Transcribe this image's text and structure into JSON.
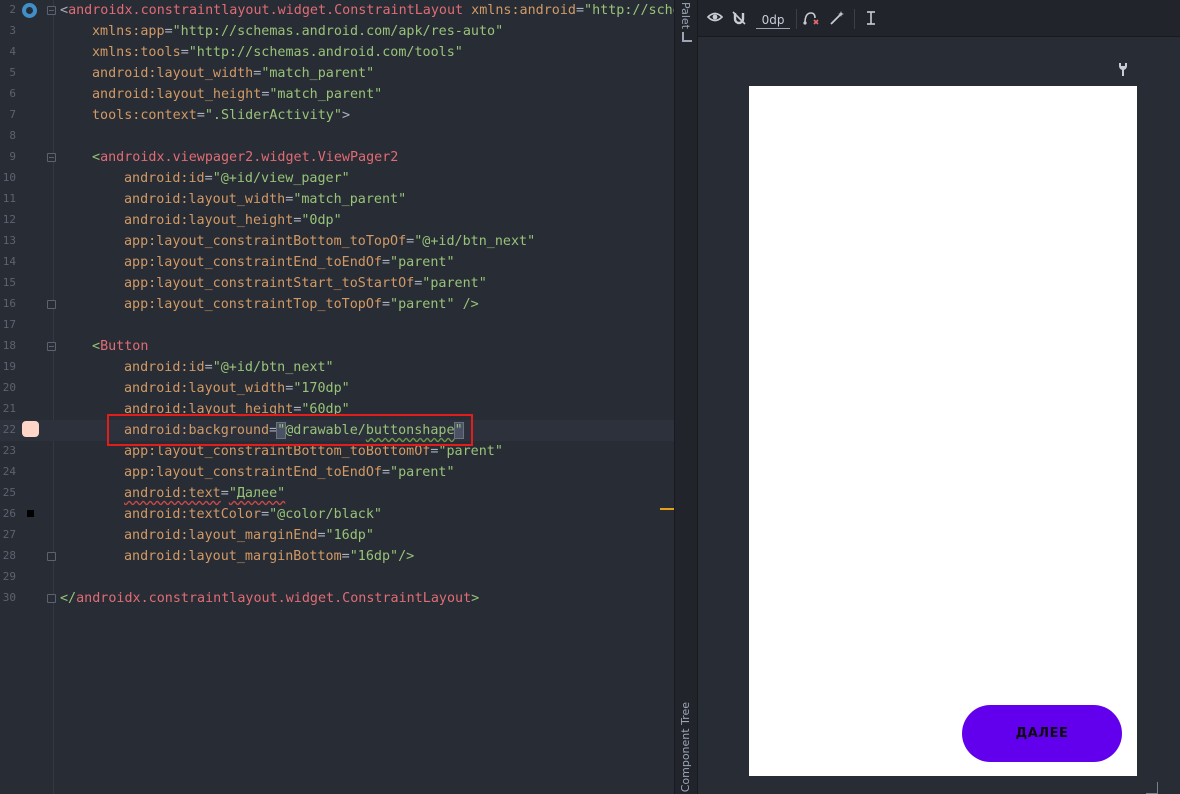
{
  "editor": {
    "lines": [
      {
        "n": "2",
        "indent": 0,
        "tokens": [
          [
            "br",
            "<"
          ],
          [
            "tag",
            "androidx.constraintlayout.widget.ConstraintLayout"
          ],
          [
            "plain",
            " "
          ],
          [
            "ns",
            "xmlns:android"
          ],
          [
            "eq",
            "="
          ],
          [
            "str",
            "\"http://sche"
          ]
        ]
      },
      {
        "n": "3",
        "indent": 1,
        "tokens": [
          [
            "ns",
            "xmlns:app"
          ],
          [
            "eq",
            "="
          ],
          [
            "str",
            "\"http://schemas.android.com/apk/res-auto\""
          ]
        ]
      },
      {
        "n": "4",
        "indent": 1,
        "tokens": [
          [
            "ns",
            "xmlns:tools"
          ],
          [
            "eq",
            "="
          ],
          [
            "str",
            "\"http://schemas.android.com/tools\""
          ]
        ]
      },
      {
        "n": "5",
        "indent": 1,
        "tokens": [
          [
            "attr",
            "android:layout_width"
          ],
          [
            "eq",
            "="
          ],
          [
            "str",
            "\"match_parent\""
          ]
        ]
      },
      {
        "n": "6",
        "indent": 1,
        "tokens": [
          [
            "attr",
            "android:layout_height"
          ],
          [
            "eq",
            "="
          ],
          [
            "str",
            "\"match_parent\""
          ]
        ]
      },
      {
        "n": "7",
        "indent": 1,
        "tokens": [
          [
            "attr",
            "tools:context"
          ],
          [
            "eq",
            "="
          ],
          [
            "str",
            "\".SliderActivity\""
          ],
          [
            "br",
            ">"
          ]
        ]
      },
      {
        "n": "8",
        "indent": 0,
        "tokens": []
      },
      {
        "n": "9",
        "indent": 1,
        "tokens": [
          [
            "br2",
            "<"
          ],
          [
            "tag",
            "androidx.viewpager2.widget.ViewPager2"
          ]
        ]
      },
      {
        "n": "10",
        "indent": 2,
        "tokens": [
          [
            "attr",
            "android:id"
          ],
          [
            "eq",
            "="
          ],
          [
            "str",
            "\"@+id/view_pager\""
          ]
        ]
      },
      {
        "n": "11",
        "indent": 2,
        "tokens": [
          [
            "attr",
            "android:layout_width"
          ],
          [
            "eq",
            "="
          ],
          [
            "str",
            "\"match_parent\""
          ]
        ]
      },
      {
        "n": "12",
        "indent": 2,
        "tokens": [
          [
            "attr",
            "android:layout_height"
          ],
          [
            "eq",
            "="
          ],
          [
            "str",
            "\"0dp\""
          ]
        ]
      },
      {
        "n": "13",
        "indent": 2,
        "tokens": [
          [
            "attr",
            "app:layout_constraintBottom_toTopOf"
          ],
          [
            "eq",
            "="
          ],
          [
            "str",
            "\"@+id/btn_next\""
          ]
        ]
      },
      {
        "n": "14",
        "indent": 2,
        "tokens": [
          [
            "attr",
            "app:layout_constraintEnd_toEndOf"
          ],
          [
            "eq",
            "="
          ],
          [
            "str",
            "\"parent\""
          ]
        ]
      },
      {
        "n": "15",
        "indent": 2,
        "tokens": [
          [
            "attr",
            "app:layout_constraintStart_toStartOf"
          ],
          [
            "eq",
            "="
          ],
          [
            "str",
            "\"parent\""
          ]
        ]
      },
      {
        "n": "16",
        "indent": 2,
        "tokens": [
          [
            "attr",
            "app:layout_constraintTop_toTopOf"
          ],
          [
            "eq",
            "="
          ],
          [
            "str",
            "\"parent\""
          ],
          [
            "plain",
            " "
          ],
          [
            "br2",
            "/>"
          ]
        ]
      },
      {
        "n": "17",
        "indent": 0,
        "tokens": []
      },
      {
        "n": "18",
        "indent": 1,
        "tokens": [
          [
            "br2",
            "<"
          ],
          [
            "tag",
            "Button"
          ]
        ]
      },
      {
        "n": "19",
        "indent": 2,
        "tokens": [
          [
            "attr",
            "android:id"
          ],
          [
            "eq",
            "="
          ],
          [
            "str",
            "\"@+id/btn_next\""
          ]
        ]
      },
      {
        "n": "20",
        "indent": 2,
        "tokens": [
          [
            "attr",
            "android:layout_width"
          ],
          [
            "eq",
            "="
          ],
          [
            "str",
            "\"170dp\""
          ]
        ]
      },
      {
        "n": "21",
        "indent": 2,
        "tokens": [
          [
            "attr",
            "android:layout_height"
          ],
          [
            "eq",
            "="
          ],
          [
            "str",
            "\"60dp\""
          ]
        ]
      },
      {
        "n": "22",
        "indent": 2,
        "current": true,
        "tokens": [
          [
            "attr",
            "android:background"
          ],
          [
            "eq",
            "="
          ],
          [
            "strbox",
            "\""
          ],
          [
            "str",
            "@drawable/"
          ],
          [
            "strsq",
            "buttonshape"
          ],
          [
            "strbox",
            "\""
          ]
        ]
      },
      {
        "n": "23",
        "indent": 2,
        "tokens": [
          [
            "attr",
            "app:layout_constraintBottom_toBottomOf"
          ],
          [
            "eq",
            "="
          ],
          [
            "str",
            "\"parent\""
          ]
        ]
      },
      {
        "n": "24",
        "indent": 2,
        "tokens": [
          [
            "attr",
            "app:layout_constraintEnd_toEndOf"
          ],
          [
            "eq",
            "="
          ],
          [
            "str",
            "\"parent\""
          ]
        ]
      },
      {
        "n": "25",
        "indent": 2,
        "tokens": [
          [
            "attrsq",
            "android:text"
          ],
          [
            "eq",
            "="
          ],
          [
            "strsqr",
            "\"Далее\""
          ]
        ]
      },
      {
        "n": "26",
        "indent": 2,
        "tokens": [
          [
            "attr",
            "android:textColor"
          ],
          [
            "eq",
            "="
          ],
          [
            "str",
            "\"@color/black\""
          ]
        ]
      },
      {
        "n": "27",
        "indent": 2,
        "tokens": [
          [
            "attr",
            "android:layout_marginEnd"
          ],
          [
            "eq",
            "="
          ],
          [
            "str",
            "\"16dp\""
          ]
        ]
      },
      {
        "n": "28",
        "indent": 2,
        "tokens": [
          [
            "attr",
            "android:layout_marginBottom"
          ],
          [
            "eq",
            "="
          ],
          [
            "str",
            "\"16dp\""
          ],
          [
            "br2",
            "/>"
          ]
        ]
      },
      {
        "n": "29",
        "indent": 0,
        "tokens": []
      },
      {
        "n": "30",
        "indent": 0,
        "tokens": [
          [
            "br2",
            "</"
          ],
          [
            "tag",
            "androidx.constraintlayout.widget.ConstraintLayout"
          ],
          [
            "br2",
            ">"
          ]
        ]
      }
    ]
  },
  "side_strip": {
    "palette_label": "Palet",
    "tree_label": "Component Tree"
  },
  "toolbar": {
    "margin_value": "0dp"
  },
  "preview": {
    "button_label": "ДАЛЕЕ",
    "button_color": "#6200ee"
  },
  "colors": {
    "highlight_border": "#e11d1d",
    "editor_bg": "#282c34"
  }
}
